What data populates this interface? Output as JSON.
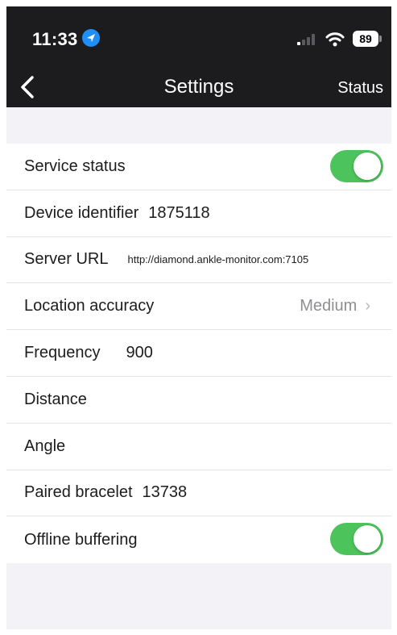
{
  "status_bar": {
    "time": "11:33",
    "battery": "89"
  },
  "nav": {
    "title": "Settings",
    "right_label": "Status"
  },
  "settings": {
    "service_status": {
      "label": "Service status",
      "enabled": true
    },
    "device_identifier": {
      "label": "Device identifier",
      "value": "1875118"
    },
    "server_url": {
      "label": "Server URL",
      "value": "http://diamond.ankle-monitor.com:7105"
    },
    "location_accuracy": {
      "label": "Location accuracy",
      "value": "Medium"
    },
    "frequency": {
      "label": "Frequency",
      "value": "900"
    },
    "distance": {
      "label": "Distance"
    },
    "angle": {
      "label": "Angle"
    },
    "paired_bracelet": {
      "label": "Paired bracelet",
      "value": "13738"
    },
    "offline_buffering": {
      "label": "Offline buffering",
      "enabled": true
    }
  },
  "colors": {
    "toggle_on": "#4cc35b",
    "nav_bg": "#1c1c1e",
    "location_blue": "#1f8ff7"
  }
}
